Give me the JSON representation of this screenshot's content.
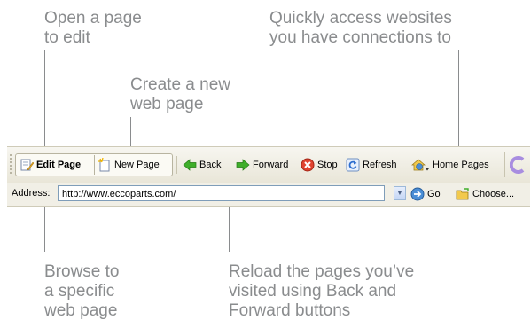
{
  "callouts": {
    "open_page": "Open a page\nto edit",
    "new_page": "Create a new\nweb page",
    "quick_access": "Quickly access websites\nyou have connections to",
    "browse": "Browse to\na specific\nweb page",
    "reload": "Reload the pages you’ve\nvisited using Back and\nForward buttons"
  },
  "toolbar": {
    "edit_page": "Edit Page",
    "new_page": "New Page",
    "back": "Back",
    "forward": "Forward",
    "stop": "Stop",
    "refresh": "Refresh",
    "home_pages": "Home Pages"
  },
  "address_bar": {
    "label": "Address:",
    "url": "http://www.eccoparts.com/",
    "go": "Go",
    "choose": "Choose..."
  },
  "colors": {
    "callout_text": "#8a8c8e",
    "back_arrow": "#3fae2a",
    "stop": "#e0432f",
    "refresh": "#2f6fcf"
  }
}
